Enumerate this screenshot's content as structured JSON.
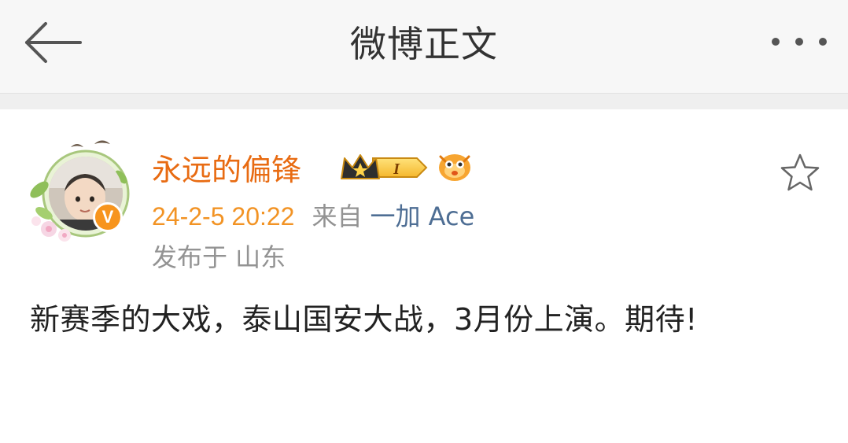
{
  "navbar": {
    "title": "微博正文",
    "back_icon": "arrow-left-icon",
    "more_icon": "more-dots-icon"
  },
  "post": {
    "author": {
      "name": "永远的偏锋",
      "verified_badge": "V",
      "vip_level": "I",
      "name_color": "#e86b12",
      "verified_color": "#f7941d"
    },
    "time": "24-2-5 20:22",
    "source_label": "来自",
    "source_device": "一加 Ace",
    "location": "发布于 山东",
    "content": "新赛季的大戏，泰山国安大战，3月份上演。期待!",
    "star_icon": "star-outline-icon"
  }
}
